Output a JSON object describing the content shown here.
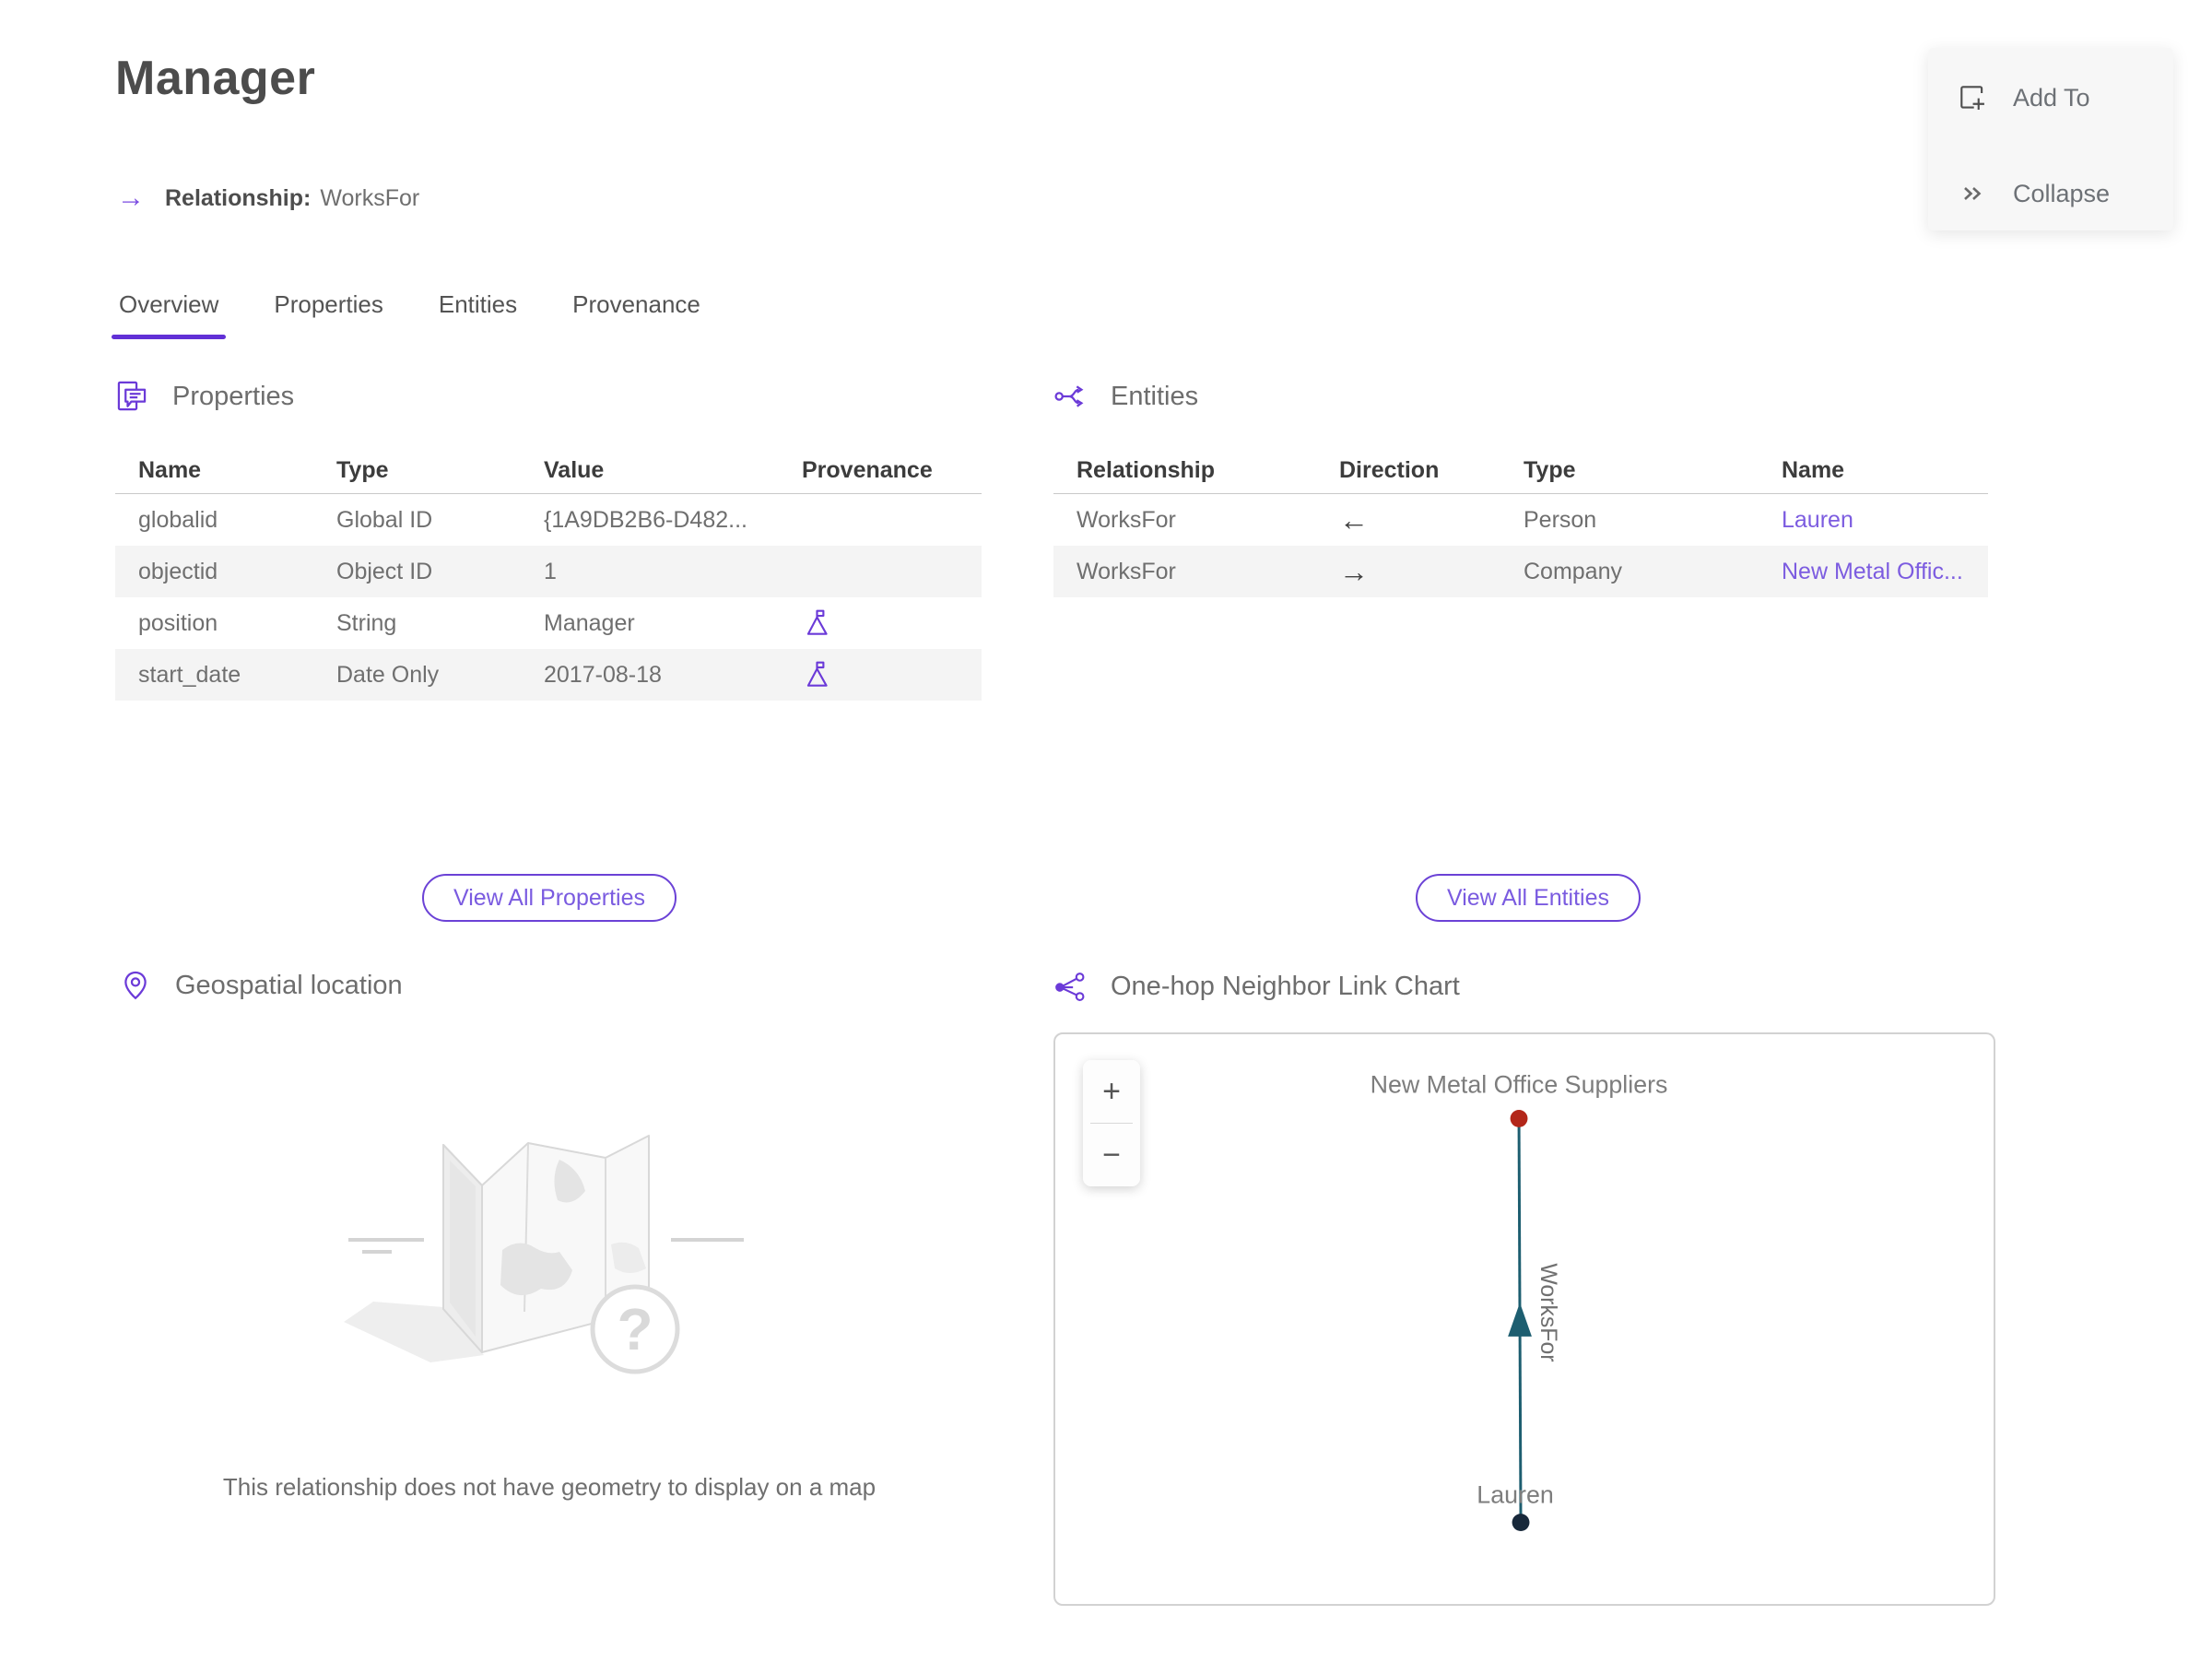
{
  "header": {
    "title": "Manager",
    "arrow_icon": "→",
    "type_label": "Relationship:",
    "type_value": "WorksFor"
  },
  "quick_actions": {
    "add_to": "Add To",
    "collapse": "Collapse"
  },
  "tabs": {
    "active": "Overview",
    "items": [
      {
        "label": "Overview"
      },
      {
        "label": "Properties"
      },
      {
        "label": "Entities"
      },
      {
        "label": "Provenance"
      }
    ]
  },
  "properties_panel": {
    "heading": "Properties",
    "columns": {
      "name": "Name",
      "type": "Type",
      "value": "Value",
      "provenance": "Provenance"
    },
    "rows": [
      {
        "name": "globalid",
        "type": "Global ID",
        "value": "{1A9DB2B6-D482...",
        "has_provenance": false
      },
      {
        "name": "objectid",
        "type": "Object ID",
        "value": "1",
        "has_provenance": false
      },
      {
        "name": "position",
        "type": "String",
        "value": "Manager",
        "has_provenance": true
      },
      {
        "name": "start_date",
        "type": "Date Only",
        "value": "2017-08-18",
        "has_provenance": true
      }
    ],
    "view_all_label": "View All Properties"
  },
  "entities_panel": {
    "heading": "Entities",
    "columns": {
      "relationship": "Relationship",
      "direction": "Direction",
      "type": "Type",
      "name": "Name"
    },
    "rows": [
      {
        "relationship": "WorksFor",
        "direction": "←",
        "type": "Person",
        "name": "Lauren"
      },
      {
        "relationship": "WorksFor",
        "direction": "→",
        "type": "Company",
        "name": "New Metal Offic..."
      }
    ],
    "view_all_label": "View All Entities"
  },
  "geospatial_panel": {
    "heading": "Geospatial location",
    "empty_message": "This relationship does not have geometry to display on a map"
  },
  "link_chart_panel": {
    "heading": "One-hop Neighbor Link Chart",
    "zoom_in": "+",
    "zoom_out": "−",
    "graph": {
      "edge_label": "WorksFor",
      "edge_color": "#1d5e70",
      "target_node": {
        "label": "New Metal Office Suppliers",
        "color": "#b3271a",
        "type": "Company"
      },
      "source_node": {
        "label": "Lauren",
        "color": "#18293b",
        "type": "Person"
      }
    }
  },
  "colors": {
    "accent_purple": "#6b3ad8",
    "tab_underline": "#6130d6",
    "link_purple": "#7c5ce0",
    "edge_teal": "#1d5e70",
    "node_red": "#b3271a",
    "node_navy": "#18293b"
  }
}
